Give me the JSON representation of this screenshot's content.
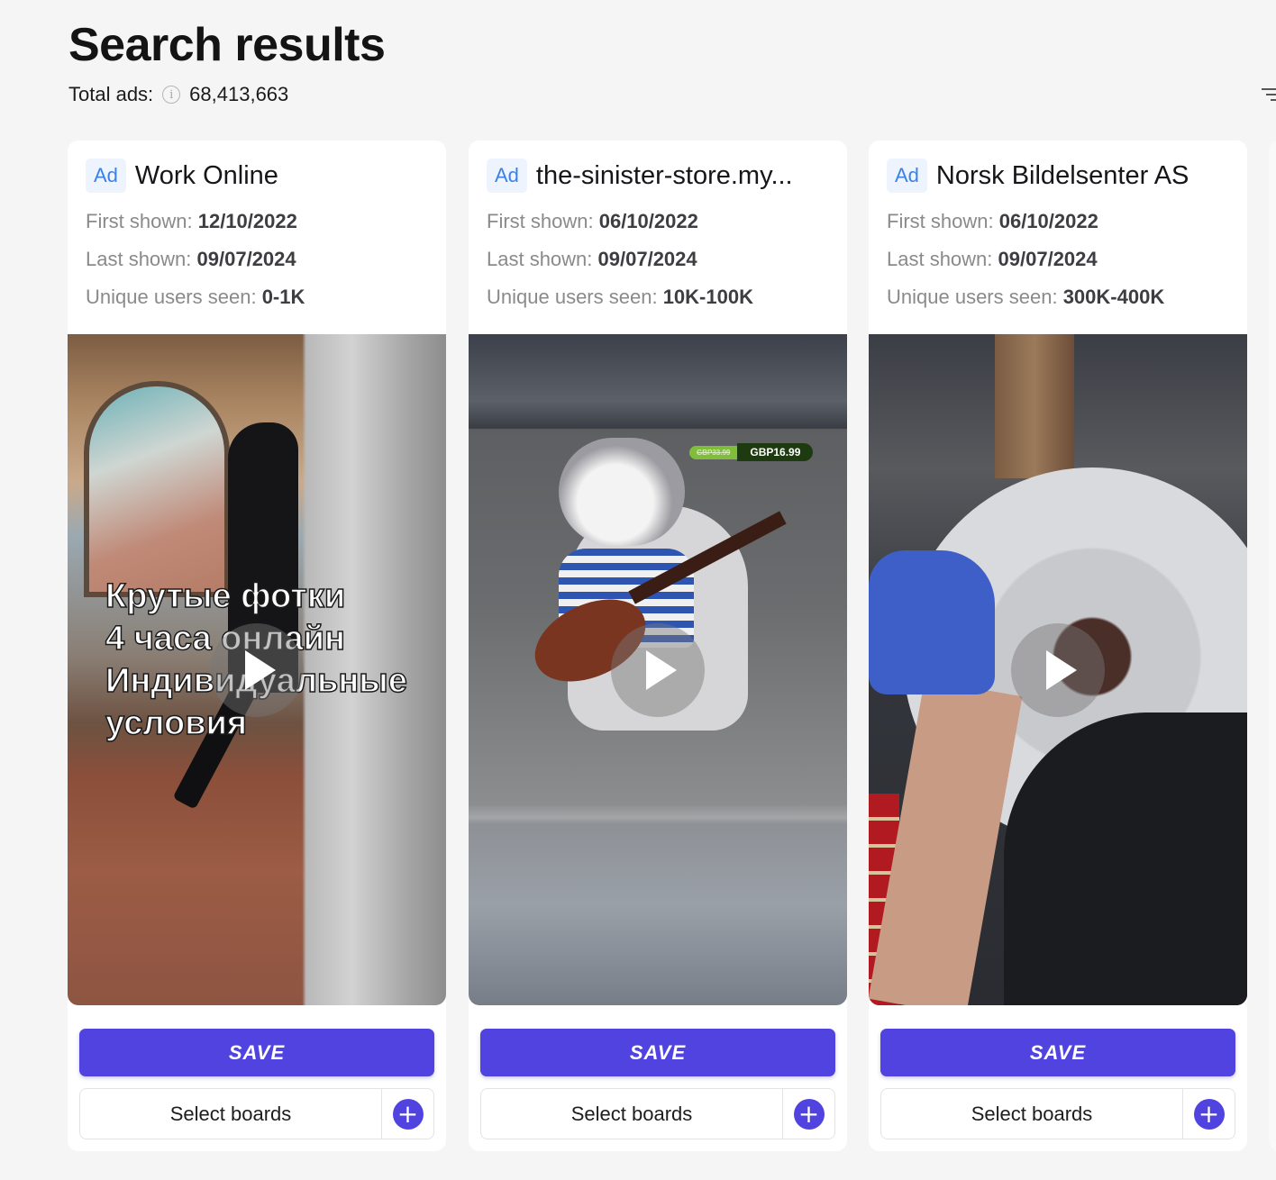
{
  "header": {
    "title": "Search results",
    "total_label": "Total ads:",
    "total_value": "68,413,663",
    "info_icon": "info-circle-icon",
    "filter_icon": "filter-sort-icon"
  },
  "colors": {
    "accent": "#5143e0",
    "ad_badge_text": "#3b82e6",
    "ad_badge_bg": "#eef4fd",
    "page_bg": "#f5f5f6"
  },
  "labels": {
    "ad_badge": "Ad",
    "first_shown": "First shown:",
    "last_shown": "Last shown:",
    "unique_users": "Unique users seen:",
    "save": "SAVE",
    "select_boards": "Select boards",
    "add_board_icon": "plus-circle-icon",
    "play_icon": "play-icon"
  },
  "cards": [
    {
      "title": "Work Online",
      "first_shown": "12/10/2022",
      "last_shown": "09/07/2024",
      "unique_users": "0-1K",
      "media_type": "video",
      "overlay_text": "Крутые фотки\n4 часа онлайн\nИндивидуальные\nусловия"
    },
    {
      "title": "the-sinister-store.my...",
      "first_shown": "06/10/2022",
      "last_shown": "09/07/2024",
      "unique_users": "10K-100K",
      "media_type": "video",
      "price_old": "GBP33.99",
      "price_new": "GBP16.99"
    },
    {
      "title": "Norsk Bildelsenter AS",
      "first_shown": "06/10/2022",
      "last_shown": "09/07/2024",
      "unique_users": "300K-400K",
      "media_type": "video"
    }
  ]
}
